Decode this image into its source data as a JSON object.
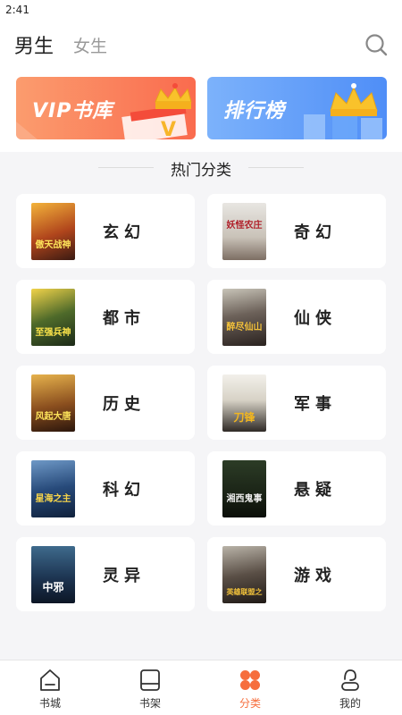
{
  "status_bar": {
    "time": "2:41"
  },
  "header": {
    "tabs": [
      {
        "label": "男生",
        "active": true
      },
      {
        "label": "女生",
        "active": false
      }
    ],
    "search_icon": "search-icon"
  },
  "banners": {
    "vip": {
      "label": "VIP书库",
      "color_from": "#fb9c6e",
      "color_to": "#fa6b4e"
    },
    "rank": {
      "label": "排行榜",
      "color_from": "#7cb2fb",
      "color_to": "#4f8ef7"
    }
  },
  "section": {
    "title": "热门分类"
  },
  "categories": [
    {
      "name": "玄幻",
      "cover_text": "傲天战神"
    },
    {
      "name": "奇幻",
      "cover_text": "妖怪农庄"
    },
    {
      "name": "都市",
      "cover_text": "至强兵神"
    },
    {
      "name": "仙侠",
      "cover_text": "醉尽仙山"
    },
    {
      "name": "历史",
      "cover_text": "风起大唐"
    },
    {
      "name": "军事",
      "cover_text": "刀锋"
    },
    {
      "name": "科幻",
      "cover_text": "星海之主"
    },
    {
      "name": "悬疑",
      "cover_text": "湘西鬼事"
    },
    {
      "name": "灵异",
      "cover_text": "中邪"
    },
    {
      "name": "游戏",
      "cover_text": "英雄联盟之"
    }
  ],
  "bottom_nav": [
    {
      "label": "书城",
      "icon": "home-icon",
      "active": false
    },
    {
      "label": "书架",
      "icon": "bookshelf-icon",
      "active": false
    },
    {
      "label": "分类",
      "icon": "category-grid-icon",
      "active": true
    },
    {
      "label": "我的",
      "icon": "profile-icon",
      "active": false
    }
  ],
  "colors": {
    "accent": "#f66e3d",
    "background": "#f5f5f7"
  }
}
